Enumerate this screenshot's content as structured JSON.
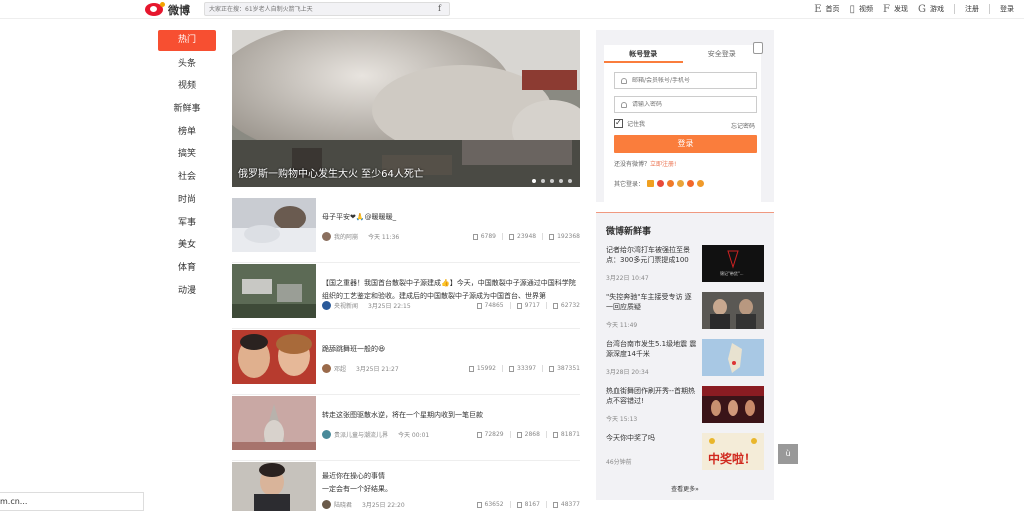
{
  "header": {
    "logo_text": "微博",
    "search_placeholder": "大家正在搜：61岁老人自制火箭飞上天",
    "nav": [
      {
        "icon": "E",
        "label": "首页"
      },
      {
        "icon": "▯",
        "label": "视频"
      },
      {
        "icon": "F",
        "label": "发现"
      },
      {
        "icon": "G",
        "label": "游戏"
      },
      {
        "icon": "",
        "label": "注册"
      },
      {
        "icon": "",
        "label": "登录"
      }
    ]
  },
  "leftnav": [
    "热门",
    "头条",
    "视频",
    "新鲜事",
    "榜单",
    "搞笑",
    "社会",
    "时尚",
    "军事",
    "美女",
    "体育",
    "动漫"
  ],
  "hero": {
    "title": "俄罗斯一购物中心发生大火 至少64人死亡"
  },
  "feed": [
    {
      "text": "母子平安❤🙏@暖暖暖_",
      "author": "我的阿崩",
      "time": "今天 11:36",
      "stats": [
        "6789",
        "23948",
        "192368"
      ]
    },
    {
      "text": "【国之重器！我国首台散裂中子源建成👍】今天，中国散裂中子源通过中国科学院组织的工艺鉴定和验收。建成后的中国散裂中子源成为中国首台、世界第",
      "author": "央视新闻",
      "time": "3月25日 22:15",
      "stats": [
        "74865",
        "9717",
        "62732"
      ]
    },
    {
      "text": "跪舔跳舞班一般的😆",
      "author": "邓超",
      "time": "3月25日 21:27",
      "stats": [
        "15992",
        "33397",
        "387351"
      ]
    },
    {
      "text": "转走这张图驱散水逆，将在一个星期内收到一笔巨款",
      "author": "贵派儿童与潮流儿界",
      "time": "今天 00:01",
      "stats": [
        "72829",
        "2868",
        "81871"
      ]
    },
    {
      "text": "最近你在操心的事情\n一定会有一个好结果。",
      "author": "陆晓君",
      "time": "3月25日 22:20",
      "stats": [
        "63652",
        "8167",
        "48377"
      ]
    }
  ],
  "login": {
    "tabs": [
      "帐号登录",
      "安全登录"
    ],
    "user_placeholder": "邮箱/会员帐号/手机号",
    "pass_placeholder": "请输入密码",
    "remember": "记住我",
    "forgot": "忘记密码",
    "button": "登录",
    "no_account": "还没有微博？",
    "register_link": "立即注册!",
    "other": "其它登录："
  },
  "fresh": {
    "title": "微博新鲜事",
    "items": [
      {
        "text": "记者给尔湾打车被强拉至景点：300多元门票提成100",
        "time": "3月22日 10:47",
        "thumb_text": "锦记\"带货\"..."
      },
      {
        "text": "\"失控奔驰\"车主接受专访 逐一回应质疑",
        "time": "今天 11:49"
      },
      {
        "text": "台湾台南市发生5.1级地震 震源深度14千米",
        "time": "3月28日 20:34"
      },
      {
        "text": "热血街舞团作刷开秀--首期热点不容错过!",
        "time": "今天 15:13"
      },
      {
        "text": "今天你中奖了吗",
        "time": "46分钟前",
        "thumb_text": "中奖啦！"
      }
    ],
    "more": "查看更多»"
  },
  "back_top": "ù",
  "statusbar": "m.cn..."
}
